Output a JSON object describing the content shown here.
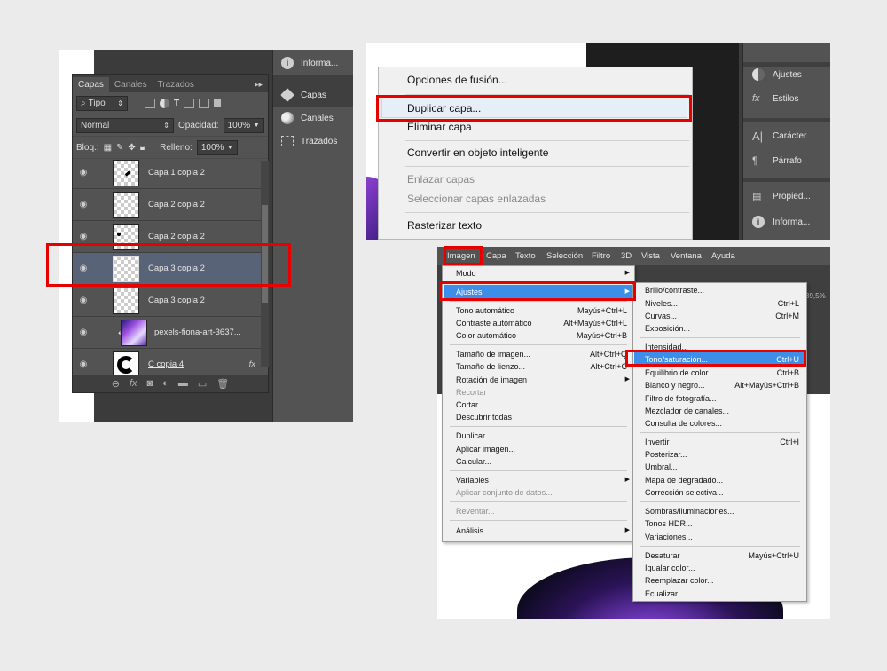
{
  "layers_panel": {
    "tabs": [
      "Capas",
      "Canales",
      "Trazados"
    ],
    "more": "▸▸",
    "filter": "Tipo",
    "blend_mode": "Normal",
    "opacity_label": "Opacidad:",
    "opacity_value": "100%",
    "lock_label": "Bloq.:",
    "fill_label": "Relleno:",
    "fill_value": "100%",
    "layers": [
      {
        "name": "Capa 1 copia 2"
      },
      {
        "name": "Capa 2 copia 2"
      },
      {
        "name": "Capa 2 copia 2"
      },
      {
        "name": "Capa 3 copia 2",
        "selected": true
      },
      {
        "name": "Capa 3 copia 2"
      },
      {
        "name": "pexels-fiona-art-3637..."
      },
      {
        "name": "C copia 4"
      }
    ],
    "fx_label": "fx",
    "footer_icons": [
      "link-icon",
      "fx-icon",
      "mask-icon",
      "adjustment-icon",
      "folder-icon",
      "new-layer-icon",
      "trash-icon"
    ],
    "side_panel": [
      {
        "label": "Informa...",
        "icon": "info-icon"
      },
      {
        "label": "Capas",
        "icon": "layers-icon"
      },
      {
        "label": "Canales",
        "icon": "channels-icon"
      },
      {
        "label": "Trazados",
        "icon": "paths-icon"
      }
    ]
  },
  "context_menu": {
    "items": [
      {
        "label": "Opciones de fusión..."
      },
      {
        "label": "Duplicar capa...",
        "highlighted": true
      },
      {
        "label": "Eliminar capa"
      },
      {
        "label": "Convertir en objeto inteligente"
      },
      {
        "label": "Enlazar capas",
        "disabled": true
      },
      {
        "label": "Seleccionar capas enlazadas",
        "disabled": true
      },
      {
        "label": "Rasterizar texto"
      }
    ],
    "side_panel": [
      {
        "label": "Ajustes",
        "icon": "adjustments-icon"
      },
      {
        "label": "Estilos",
        "icon": "styles-icon"
      },
      {
        "label": "Carácter",
        "icon": "character-icon"
      },
      {
        "label": "Párrafo",
        "icon": "paragraph-icon"
      },
      {
        "label": "Propied...",
        "icon": "properties-icon"
      },
      {
        "label": "Informa...",
        "icon": "info-icon"
      }
    ]
  },
  "imagen_menu": {
    "menubar": [
      "Imagen",
      "Capa",
      "Texto",
      "Selección",
      "Filtro",
      "3D",
      "Vista",
      "Ventana",
      "Ayuda"
    ],
    "zoom_hint": "39,5%",
    "main_items": [
      {
        "label": "Modo",
        "submenu": true
      },
      {
        "label": "Ajustes",
        "submenu": true,
        "highlighted": true
      },
      {
        "label": "Tono automático",
        "shortcut": "Mayús+Ctrl+L"
      },
      {
        "label": "Contraste automático",
        "shortcut": "Alt+Mayús+Ctrl+L"
      },
      {
        "label": "Color automático",
        "shortcut": "Mayús+Ctrl+B"
      },
      {
        "label": "Tamaño de imagen...",
        "shortcut": "Alt+Ctrl+Q"
      },
      {
        "label": "Tamaño de lienzo...",
        "shortcut": "Alt+Ctrl+C"
      },
      {
        "label": "Rotación de imagen",
        "submenu": true
      },
      {
        "label": "Recortar",
        "disabled": true
      },
      {
        "label": "Cortar..."
      },
      {
        "label": "Descubrir todas"
      },
      {
        "label": "Duplicar..."
      },
      {
        "label": "Aplicar imagen..."
      },
      {
        "label": "Calcular..."
      },
      {
        "label": "Variables",
        "submenu": true
      },
      {
        "label": "Aplicar conjunto de datos...",
        "disabled": true
      },
      {
        "label": "Reventar...",
        "disabled": true
      },
      {
        "label": "Análisis",
        "submenu": true
      }
    ],
    "sub_items": [
      {
        "label": "Brillo/contraste..."
      },
      {
        "label": "Niveles...",
        "shortcut": "Ctrl+L"
      },
      {
        "label": "Curvas...",
        "shortcut": "Ctrl+M"
      },
      {
        "label": "Exposición..."
      },
      {
        "label": "Intensidad..."
      },
      {
        "label": "Tono/saturación...",
        "shortcut": "Ctrl+U",
        "highlighted": true
      },
      {
        "label": "Equilibrio de color...",
        "shortcut": "Ctrl+B"
      },
      {
        "label": "Blanco y negro...",
        "shortcut": "Alt+Mayús+Ctrl+B"
      },
      {
        "label": "Filtro de fotografía..."
      },
      {
        "label": "Mezclador de canales..."
      },
      {
        "label": "Consulta de colores..."
      },
      {
        "label": "Invertir",
        "shortcut": "Ctrl+I"
      },
      {
        "label": "Posterizar..."
      },
      {
        "label": "Umbral..."
      },
      {
        "label": "Mapa de degradado..."
      },
      {
        "label": "Corrección selectiva..."
      },
      {
        "label": "Sombras/iluminaciones..."
      },
      {
        "label": "Tonos HDR..."
      },
      {
        "label": "Variaciones..."
      },
      {
        "label": "Desaturar",
        "shortcut": "Mayús+Ctrl+U"
      },
      {
        "label": "Igualar color..."
      },
      {
        "label": "Reemplazar color..."
      },
      {
        "label": "Ecualizar"
      }
    ]
  },
  "colors": {
    "highlight_red": "#e60000",
    "menu_blue": "#3d8ee8",
    "panel_dark": "#535353"
  }
}
